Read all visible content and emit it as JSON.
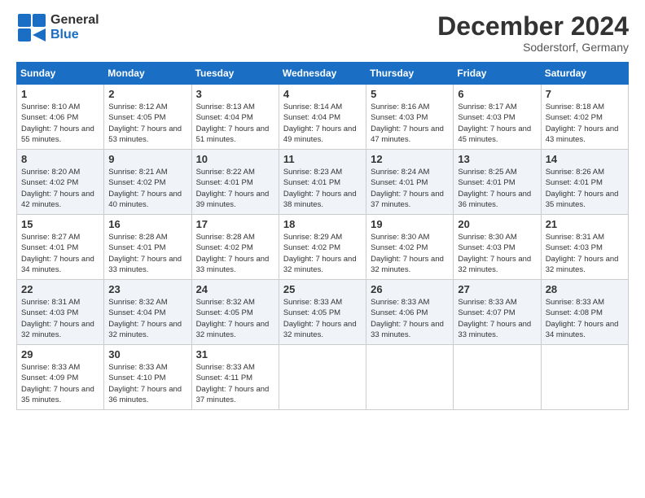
{
  "header": {
    "logo": {
      "general": "General",
      "blue": "Blue"
    },
    "title": "December 2024",
    "location": "Soderstorf, Germany"
  },
  "calendar": {
    "days_of_week": [
      "Sunday",
      "Monday",
      "Tuesday",
      "Wednesday",
      "Thursday",
      "Friday",
      "Saturday"
    ],
    "weeks": [
      [
        {
          "day": "1",
          "sunrise": "Sunrise: 8:10 AM",
          "sunset": "Sunset: 4:06 PM",
          "daylight": "Daylight: 7 hours and 55 minutes."
        },
        {
          "day": "2",
          "sunrise": "Sunrise: 8:12 AM",
          "sunset": "Sunset: 4:05 PM",
          "daylight": "Daylight: 7 hours and 53 minutes."
        },
        {
          "day": "3",
          "sunrise": "Sunrise: 8:13 AM",
          "sunset": "Sunset: 4:04 PM",
          "daylight": "Daylight: 7 hours and 51 minutes."
        },
        {
          "day": "4",
          "sunrise": "Sunrise: 8:14 AM",
          "sunset": "Sunset: 4:04 PM",
          "daylight": "Daylight: 7 hours and 49 minutes."
        },
        {
          "day": "5",
          "sunrise": "Sunrise: 8:16 AM",
          "sunset": "Sunset: 4:03 PM",
          "daylight": "Daylight: 7 hours and 47 minutes."
        },
        {
          "day": "6",
          "sunrise": "Sunrise: 8:17 AM",
          "sunset": "Sunset: 4:03 PM",
          "daylight": "Daylight: 7 hours and 45 minutes."
        },
        {
          "day": "7",
          "sunrise": "Sunrise: 8:18 AM",
          "sunset": "Sunset: 4:02 PM",
          "daylight": "Daylight: 7 hours and 43 minutes."
        }
      ],
      [
        {
          "day": "8",
          "sunrise": "Sunrise: 8:20 AM",
          "sunset": "Sunset: 4:02 PM",
          "daylight": "Daylight: 7 hours and 42 minutes."
        },
        {
          "day": "9",
          "sunrise": "Sunrise: 8:21 AM",
          "sunset": "Sunset: 4:02 PM",
          "daylight": "Daylight: 7 hours and 40 minutes."
        },
        {
          "day": "10",
          "sunrise": "Sunrise: 8:22 AM",
          "sunset": "Sunset: 4:01 PM",
          "daylight": "Daylight: 7 hours and 39 minutes."
        },
        {
          "day": "11",
          "sunrise": "Sunrise: 8:23 AM",
          "sunset": "Sunset: 4:01 PM",
          "daylight": "Daylight: 7 hours and 38 minutes."
        },
        {
          "day": "12",
          "sunrise": "Sunrise: 8:24 AM",
          "sunset": "Sunset: 4:01 PM",
          "daylight": "Daylight: 7 hours and 37 minutes."
        },
        {
          "day": "13",
          "sunrise": "Sunrise: 8:25 AM",
          "sunset": "Sunset: 4:01 PM",
          "daylight": "Daylight: 7 hours and 36 minutes."
        },
        {
          "day": "14",
          "sunrise": "Sunrise: 8:26 AM",
          "sunset": "Sunset: 4:01 PM",
          "daylight": "Daylight: 7 hours and 35 minutes."
        }
      ],
      [
        {
          "day": "15",
          "sunrise": "Sunrise: 8:27 AM",
          "sunset": "Sunset: 4:01 PM",
          "daylight": "Daylight: 7 hours and 34 minutes."
        },
        {
          "day": "16",
          "sunrise": "Sunrise: 8:28 AM",
          "sunset": "Sunset: 4:01 PM",
          "daylight": "Daylight: 7 hours and 33 minutes."
        },
        {
          "day": "17",
          "sunrise": "Sunrise: 8:28 AM",
          "sunset": "Sunset: 4:02 PM",
          "daylight": "Daylight: 7 hours and 33 minutes."
        },
        {
          "day": "18",
          "sunrise": "Sunrise: 8:29 AM",
          "sunset": "Sunset: 4:02 PM",
          "daylight": "Daylight: 7 hours and 32 minutes."
        },
        {
          "day": "19",
          "sunrise": "Sunrise: 8:30 AM",
          "sunset": "Sunset: 4:02 PM",
          "daylight": "Daylight: 7 hours and 32 minutes."
        },
        {
          "day": "20",
          "sunrise": "Sunrise: 8:30 AM",
          "sunset": "Sunset: 4:03 PM",
          "daylight": "Daylight: 7 hours and 32 minutes."
        },
        {
          "day": "21",
          "sunrise": "Sunrise: 8:31 AM",
          "sunset": "Sunset: 4:03 PM",
          "daylight": "Daylight: 7 hours and 32 minutes."
        }
      ],
      [
        {
          "day": "22",
          "sunrise": "Sunrise: 8:31 AM",
          "sunset": "Sunset: 4:03 PM",
          "daylight": "Daylight: 7 hours and 32 minutes."
        },
        {
          "day": "23",
          "sunrise": "Sunrise: 8:32 AM",
          "sunset": "Sunset: 4:04 PM",
          "daylight": "Daylight: 7 hours and 32 minutes."
        },
        {
          "day": "24",
          "sunrise": "Sunrise: 8:32 AM",
          "sunset": "Sunset: 4:05 PM",
          "daylight": "Daylight: 7 hours and 32 minutes."
        },
        {
          "day": "25",
          "sunrise": "Sunrise: 8:33 AM",
          "sunset": "Sunset: 4:05 PM",
          "daylight": "Daylight: 7 hours and 32 minutes."
        },
        {
          "day": "26",
          "sunrise": "Sunrise: 8:33 AM",
          "sunset": "Sunset: 4:06 PM",
          "daylight": "Daylight: 7 hours and 33 minutes."
        },
        {
          "day": "27",
          "sunrise": "Sunrise: 8:33 AM",
          "sunset": "Sunset: 4:07 PM",
          "daylight": "Daylight: 7 hours and 33 minutes."
        },
        {
          "day": "28",
          "sunrise": "Sunrise: 8:33 AM",
          "sunset": "Sunset: 4:08 PM",
          "daylight": "Daylight: 7 hours and 34 minutes."
        }
      ],
      [
        {
          "day": "29",
          "sunrise": "Sunrise: 8:33 AM",
          "sunset": "Sunset: 4:09 PM",
          "daylight": "Daylight: 7 hours and 35 minutes."
        },
        {
          "day": "30",
          "sunrise": "Sunrise: 8:33 AM",
          "sunset": "Sunset: 4:10 PM",
          "daylight": "Daylight: 7 hours and 36 minutes."
        },
        {
          "day": "31",
          "sunrise": "Sunrise: 8:33 AM",
          "sunset": "Sunset: 4:11 PM",
          "daylight": "Daylight: 7 hours and 37 minutes."
        },
        null,
        null,
        null,
        null
      ]
    ]
  }
}
